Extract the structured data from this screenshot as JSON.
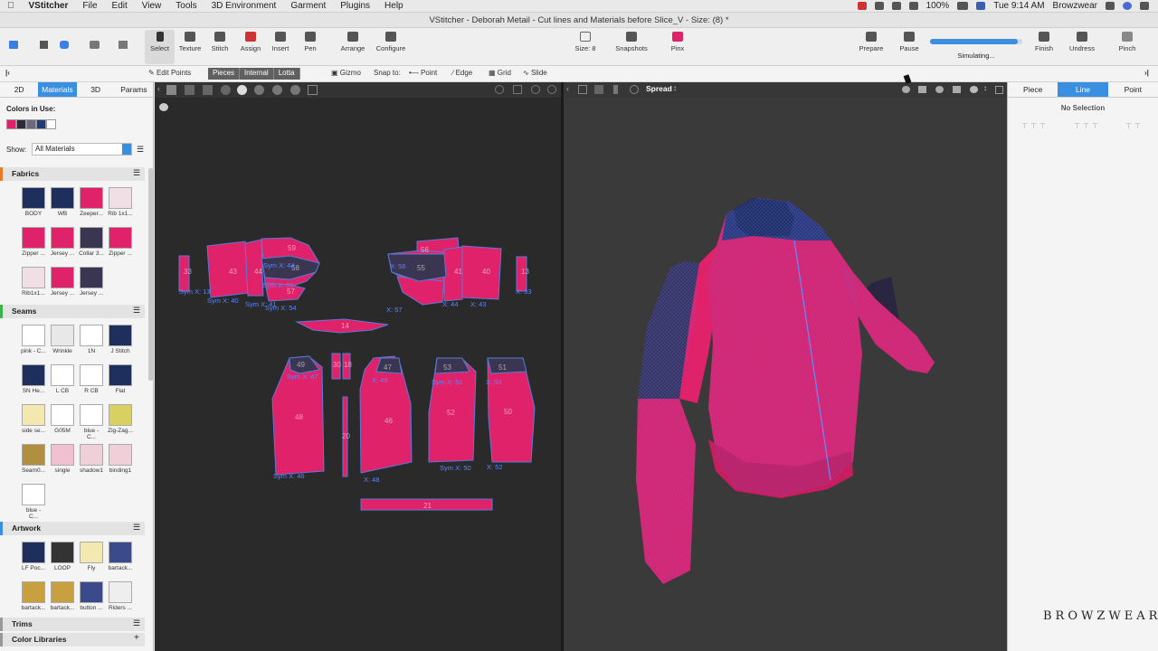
{
  "menubar": {
    "app": "VStitcher",
    "items": [
      "File",
      "Edit",
      "View",
      "Tools",
      "3D Environment",
      "Garment",
      "Plugins",
      "Help"
    ],
    "battery": "100%",
    "clock": "Tue 9:14 AM",
    "user": "Browzwear"
  },
  "window": {
    "title": "VStitcher - Deborah Metail - Cut lines and Materials before Slice_V - Size: (8) *"
  },
  "toolbar": {
    "tools": [
      "Select",
      "Texture",
      "Stitch",
      "Assign",
      "Insert",
      "Pen",
      "Arrange",
      "Configure"
    ],
    "size": "Size: 8",
    "snapshots": "Snapshots",
    "color": "Pinx",
    "prepare": "Prepare",
    "pause": "Pause",
    "status": "Simulating...",
    "progress": 0.95,
    "finish": "Finish",
    "undress": "Undress",
    "pinch": "Pinch"
  },
  "toolbar2": {
    "edit_points": "Edit Points",
    "segments": [
      "Pieces",
      "Internal",
      "Lotta"
    ],
    "gizmo": "Gizmo",
    "snap": "Snap to:",
    "point": "Point",
    "edge": "Edge",
    "grid": "Grid",
    "slide": "Slide"
  },
  "left": {
    "tabs": [
      "2D",
      "Materials",
      "3D",
      "Params"
    ],
    "colors_label": "Colors in Use:",
    "colors": [
      "#e0226a",
      "#2b2b3a",
      "#6a6a7a",
      "#1e3a78",
      "#ffffff"
    ],
    "show_label": "Show:",
    "show_value": "All Materials",
    "fabrics_title": "Fabrics",
    "fabrics": [
      "BODY",
      "WB",
      "Zeeper...",
      "Rib 1x1...",
      "Zipper ...",
      "Jersey ...",
      "Collar 3...",
      "Zipper ...",
      "Rib1x1...",
      "Jersey ...",
      "Jersey ..."
    ],
    "seams_title": "Seams",
    "seams": [
      "pink - C...",
      "Wrinkle",
      "1N",
      "J Stitch",
      "SN He...",
      "L CB",
      "R CB",
      "Flat",
      "side se...",
      "G05M",
      "blue - C...",
      "Zig-Zag...",
      "Seam0...",
      "single",
      "shadow1",
      "binding1",
      "blue - C..."
    ],
    "artwork_title": "Artwork",
    "artwork": [
      "LF Poc...",
      "LOOP",
      "Fly",
      "bartack...",
      "bartack...",
      "bartack...",
      "button ...",
      "Riders ..."
    ],
    "trims_title": "Trims",
    "libraries_title": "Color Libraries"
  },
  "view3d": {
    "mode": "Spread"
  },
  "right": {
    "tabs": [
      "Piece",
      "Line",
      "Point"
    ],
    "selection": "No Selection"
  },
  "pieces": {
    "labels": [
      "33",
      "43",
      "44",
      "59",
      "58",
      "Sym X: 44",
      "Sym X: 55",
      "57",
      "56",
      "55",
      "41",
      "40",
      "13",
      "X: 56",
      "X: 57",
      "X: 44",
      "X: 43",
      "X: 33",
      "Sym X: 13",
      "Sym X: 40",
      "Sym X: 41",
      "Sym X: 54",
      "14",
      "49",
      "30",
      "18",
      "47",
      "53",
      "51",
      "48",
      "46",
      "52",
      "50",
      "20",
      "Sym X: 47",
      "X: 49",
      "Sym X: 51",
      "X: 53",
      "Sym X: 46",
      "X: 48",
      "Sym X: 50",
      "X: 52",
      "21"
    ]
  },
  "brand": "BROWZWEAR"
}
